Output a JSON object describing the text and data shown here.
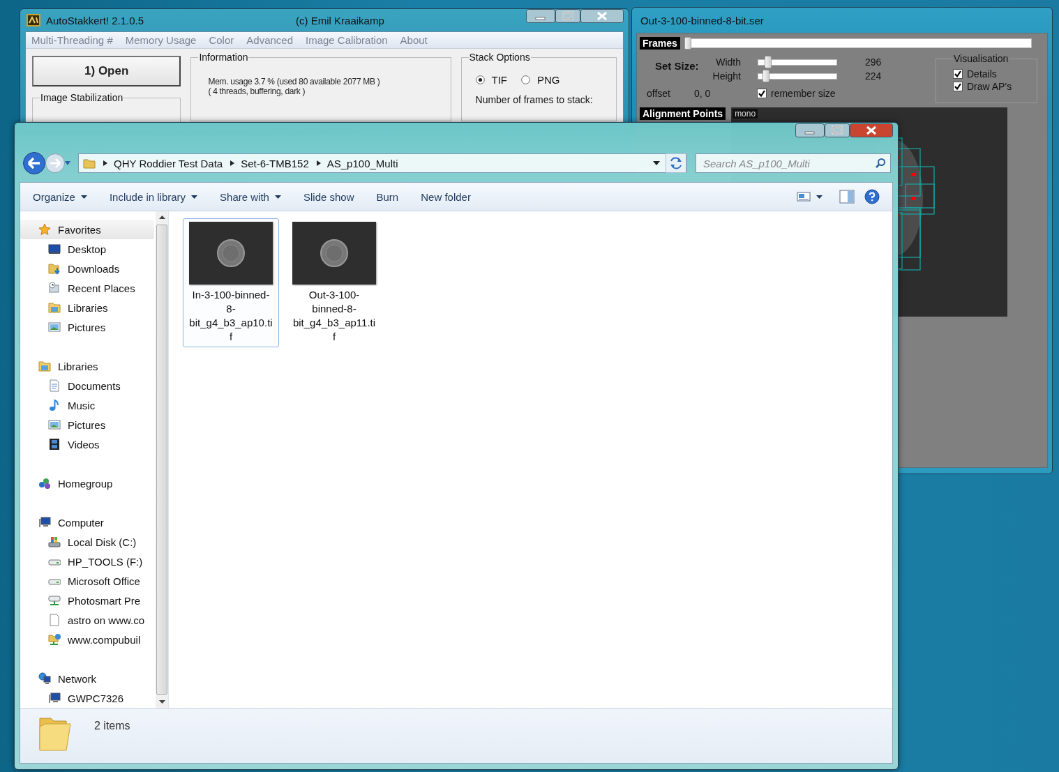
{
  "autostakkert": {
    "title": "AutoStakkert! 2.1.0.5",
    "credit": "(c) Emil Kraaikamp",
    "menu": [
      "Multi-Threading #",
      "Memory Usage",
      "Color",
      "Advanced",
      "Image Calibration",
      "About"
    ],
    "open_button": "1) Open",
    "image_stabilization": "Image Stabilization",
    "information": {
      "title": "Information",
      "lines": [
        "Mem. usage 3.7 %  (used 80 available 2077 MB )",
        "( 4 threads, buffering, dark  )"
      ]
    },
    "stack_options": {
      "title": "Stack Options",
      "formats": [
        {
          "label": "TIF",
          "selected": true
        },
        {
          "label": "PNG",
          "selected": false
        }
      ],
      "frames_label": "Number of frames to stack:"
    }
  },
  "frame_window": {
    "title": "Out-3-100-binned-8-bit.ser",
    "frames_label": "Frames",
    "frames_slider": {
      "level": 0.0
    },
    "set_size_label": "Set Size:",
    "sliders": [
      {
        "label": "Width",
        "level": 0.1,
        "reading": "296"
      },
      {
        "label": "Height",
        "level": 0.07,
        "reading": "224"
      }
    ],
    "offset_label": "offset",
    "offset_value": "0, 0",
    "remember_size": {
      "label": "remember size",
      "checked": true
    },
    "visualisation": {
      "title": "Visualisation",
      "options": [
        {
          "label": "Details",
          "checked": true
        },
        {
          "label": "Draw AP's",
          "checked": true
        }
      ]
    },
    "alignment_label": "Alignment Points",
    "mode_tag": "mono"
  },
  "explorer": {
    "breadcrumb": [
      "QHY Roddier Test Data",
      "Set-6-TMB152",
      "AS_p100_Multi"
    ],
    "search_placeholder": "Search AS_p100_Multi",
    "toolbar": [
      {
        "label": "Organize",
        "dropdown": true
      },
      {
        "label": "Include in library",
        "dropdown": true
      },
      {
        "label": "Share with",
        "dropdown": true
      },
      {
        "label": "Slide show",
        "dropdown": false
      },
      {
        "label": "Burn",
        "dropdown": false
      },
      {
        "label": "New folder",
        "dropdown": false
      }
    ],
    "nav": [
      {
        "label": "Favorites",
        "kind": "star",
        "selected": true,
        "children": [
          {
            "label": "Desktop",
            "kind": "desktop"
          },
          {
            "label": "Downloads",
            "kind": "downloads"
          },
          {
            "label": "Recent Places",
            "kind": "recent"
          },
          {
            "label": "Libraries",
            "kind": "library"
          },
          {
            "label": "Pictures",
            "kind": "pictures"
          }
        ]
      },
      {
        "label": "Libraries",
        "kind": "library",
        "selected": false,
        "children": [
          {
            "label": "Documents",
            "kind": "document"
          },
          {
            "label": "Music",
            "kind": "music"
          },
          {
            "label": "Pictures",
            "kind": "pictures"
          },
          {
            "label": "Videos",
            "kind": "video"
          }
        ]
      },
      {
        "label": "Homegroup",
        "kind": "homegroup",
        "selected": false
      },
      {
        "label": "Computer",
        "kind": "computer",
        "selected": false,
        "children": [
          {
            "label": "Local Disk (C:)",
            "kind": "systemdisk"
          },
          {
            "label": "HP_TOOLS (F:)",
            "kind": "drive"
          },
          {
            "label": "Microsoft Office",
            "kind": "drive"
          },
          {
            "label": "Photosmart Pre",
            "kind": "netdrive"
          },
          {
            "label": "astro on www.co",
            "kind": "file"
          },
          {
            "label": "www.compubuil",
            "kind": "netfolder"
          }
        ]
      },
      {
        "label": "Network",
        "kind": "network",
        "selected": false,
        "children": [
          {
            "label": "GWPC7326",
            "kind": "computer"
          }
        ]
      }
    ],
    "files": [
      {
        "name": "In-3-100-binned-8-bit_g4_b3_ap10.tif",
        "selected": true
      },
      {
        "name": "Out-3-100-binned-8-bit_g4_b3_ap11.tif",
        "selected": false
      }
    ],
    "status": "2 items"
  }
}
